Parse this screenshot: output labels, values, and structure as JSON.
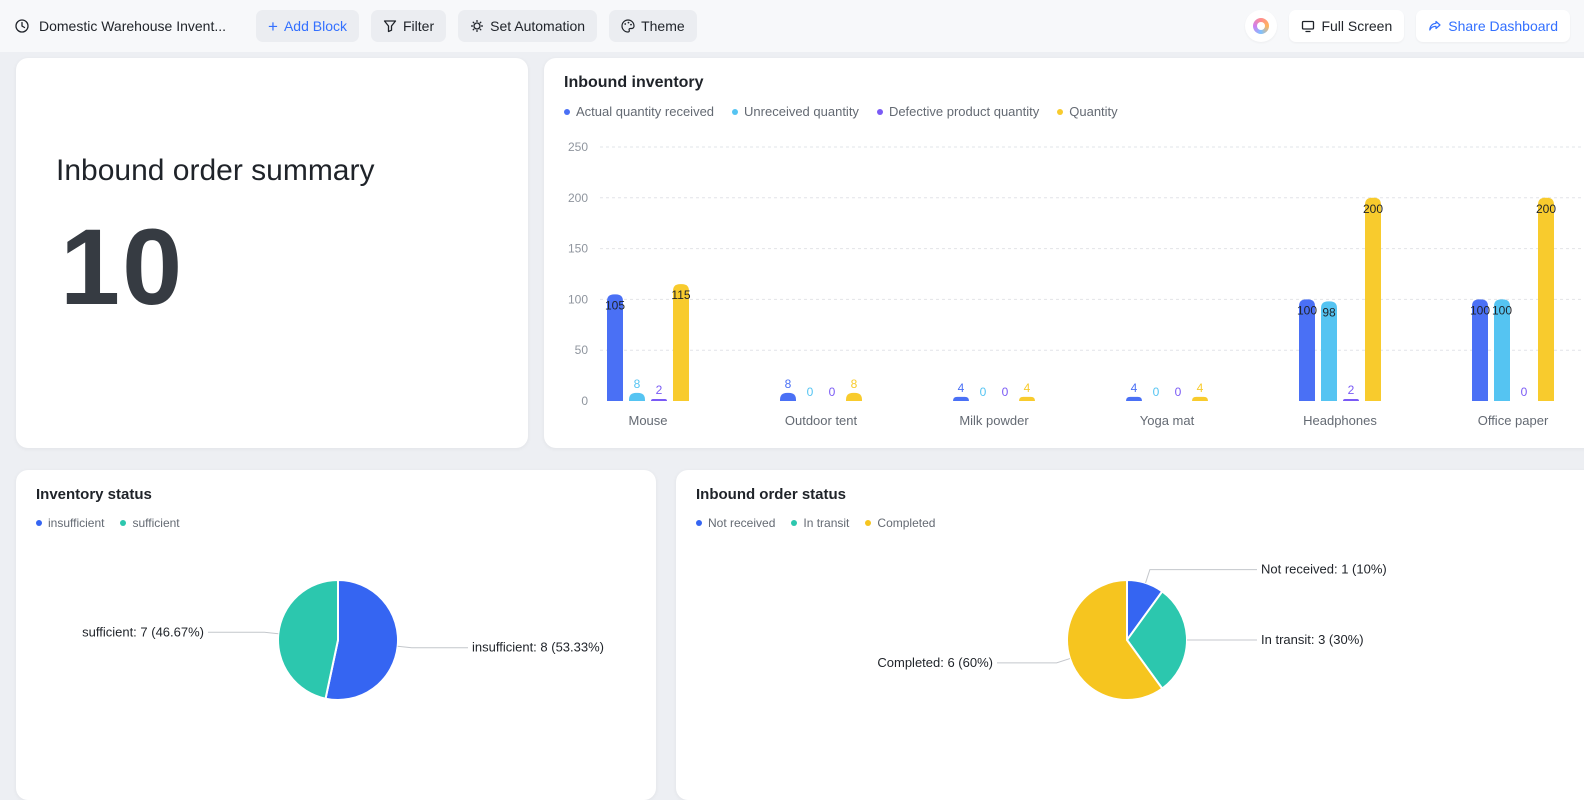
{
  "toolbar": {
    "title": "Domestic Warehouse Invent...",
    "buttons": {
      "add_block": "Add Block",
      "filter": "Filter",
      "set_automation": "Set Automation",
      "theme": "Theme",
      "full_screen": "Full Screen",
      "share_dashboard": "Share Dashboard"
    }
  },
  "summary": {
    "title": "Inbound order summary",
    "value": "10"
  },
  "chart_data": [
    {
      "type": "bar",
      "title": "Inbound inventory",
      "categories": [
        "Mouse",
        "Outdoor tent",
        "Milk powder",
        "Yoga mat",
        "Headphones",
        "Office paper"
      ],
      "series": [
        {
          "name": "Actual quantity received",
          "color": "#4a70f5",
          "values": [
            105,
            8,
            4,
            4,
            100,
            100
          ]
        },
        {
          "name": "Unreceived quantity",
          "color": "#55c4f2",
          "values": [
            8,
            0,
            0,
            0,
            98,
            100
          ]
        },
        {
          "name": "Defective product quantity",
          "color": "#7a5af5",
          "values": [
            2,
            0,
            0,
            0,
            2,
            0
          ]
        },
        {
          "name": "Quantity",
          "color": "#f8cb2d",
          "values": [
            115,
            8,
            4,
            4,
            200,
            200
          ]
        }
      ],
      "ylim": [
        0,
        250
      ],
      "yticks": [
        0,
        50,
        100,
        150,
        200,
        250
      ],
      "legend_position": "top",
      "grid": "dashed-horizontal"
    },
    {
      "type": "pie",
      "title": "Inventory status",
      "slices": [
        {
          "name": "insufficient",
          "value": 8,
          "color": "#3565f2",
          "label": "insufficient: 8 (53.33%)"
        },
        {
          "name": "sufficient",
          "value": 7,
          "color": "#2cc7ae",
          "label": "sufficient: 7 (46.67%)"
        }
      ],
      "legend_position": "top"
    },
    {
      "type": "pie",
      "title": "Inbound order status",
      "slices": [
        {
          "name": "Not received",
          "value": 1,
          "color": "#3565f2",
          "label": "Not received: 1 (10%)"
        },
        {
          "name": "In transit",
          "value": 3,
          "color": "#2cc7ae",
          "label": "In transit: 3 (30%)"
        },
        {
          "name": "Completed",
          "value": 6,
          "color": "#f6c51f",
          "label": "Completed: 6 (60%)"
        }
      ],
      "legend_position": "top"
    }
  ]
}
